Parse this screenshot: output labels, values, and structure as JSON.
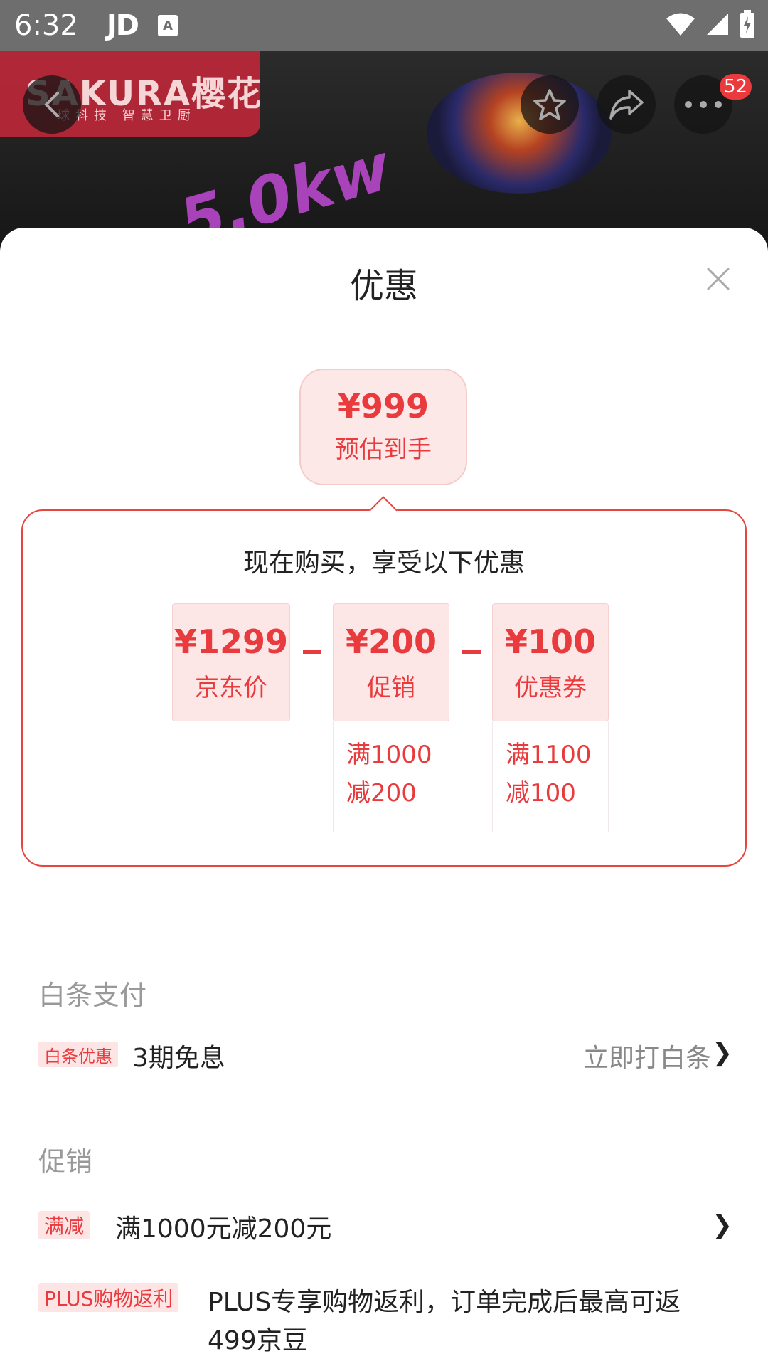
{
  "status_bar": {
    "time": "6:32",
    "app_label": "JD",
    "app_badge": "A"
  },
  "hero": {
    "brand": "SAKURA樱花",
    "brand_sub": "球科技 智慧卫厨",
    "promo_text": "5.0kw",
    "cart_count": "52"
  },
  "sheet": {
    "title": "优惠",
    "estimate": {
      "price": "¥999",
      "label": "预估到手"
    },
    "calc": {
      "heading": "现在购买，享受以下优惠",
      "items": [
        {
          "value": "¥1299",
          "label": "京东价"
        },
        {
          "value": "¥200",
          "label": "促销",
          "note_line1": "满1000",
          "note_line2": "减200"
        },
        {
          "value": "¥100",
          "label": "优惠券",
          "note_line1": "满1100",
          "note_line2": "减100"
        }
      ]
    },
    "baitiao": {
      "section_title": "白条支付",
      "tag": "白条优惠",
      "text": "3期免息",
      "link": "立即打白条"
    },
    "promo": {
      "section_title": "促销",
      "items": [
        {
          "tag": "满减",
          "text": "满1000元减200元"
        },
        {
          "tag": "PLUS购物返利",
          "text_line1": "PLUS专享购物返利，订单完成后最高可返",
          "text_line2": "499京豆"
        }
      ]
    }
  },
  "colors": {
    "accent": "#e93b3d",
    "tag_bg": "#fde5e5",
    "status_bar": "#6e6e6e"
  }
}
